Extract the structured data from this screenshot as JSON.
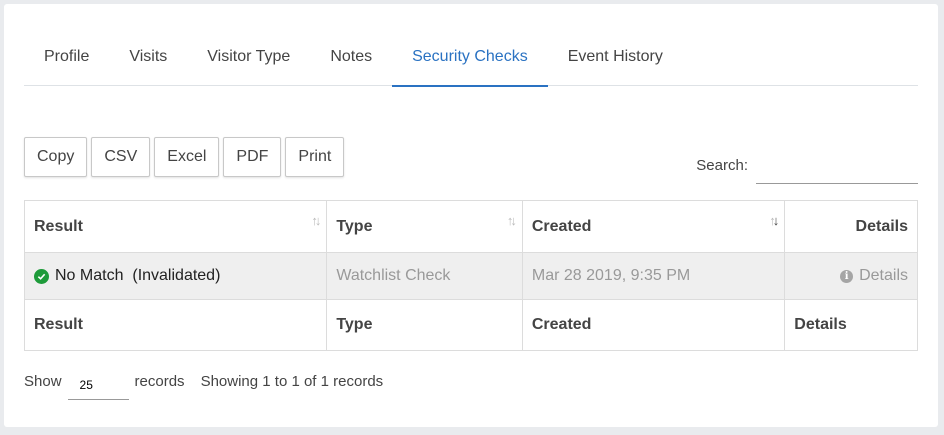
{
  "tabs": [
    {
      "label": "Profile",
      "active": false
    },
    {
      "label": "Visits",
      "active": false
    },
    {
      "label": "Visitor Type",
      "active": false
    },
    {
      "label": "Notes",
      "active": false
    },
    {
      "label": "Security Checks",
      "active": true
    },
    {
      "label": "Event History",
      "active": false
    }
  ],
  "export_buttons": [
    "Copy",
    "CSV",
    "Excel",
    "PDF",
    "Print"
  ],
  "search": {
    "label": "Search:",
    "value": "",
    "placeholder": ""
  },
  "table": {
    "headers": [
      "Result",
      "Type",
      "Created",
      "Details"
    ],
    "rows": [
      {
        "result": "No Match  (Invalidated)",
        "type": "Watchlist Check",
        "created": "Mar 28 2019, 9:35 PM",
        "details": "Details"
      }
    ],
    "footers": [
      "Result",
      "Type",
      "Created",
      "Details"
    ]
  },
  "footer": {
    "show_label": "Show",
    "page_size": "25",
    "records_label": "records",
    "info": "Showing 1 to 1 of 1 records"
  },
  "colors": {
    "accent": "#2a72c2",
    "success": "#1e9b3a"
  }
}
